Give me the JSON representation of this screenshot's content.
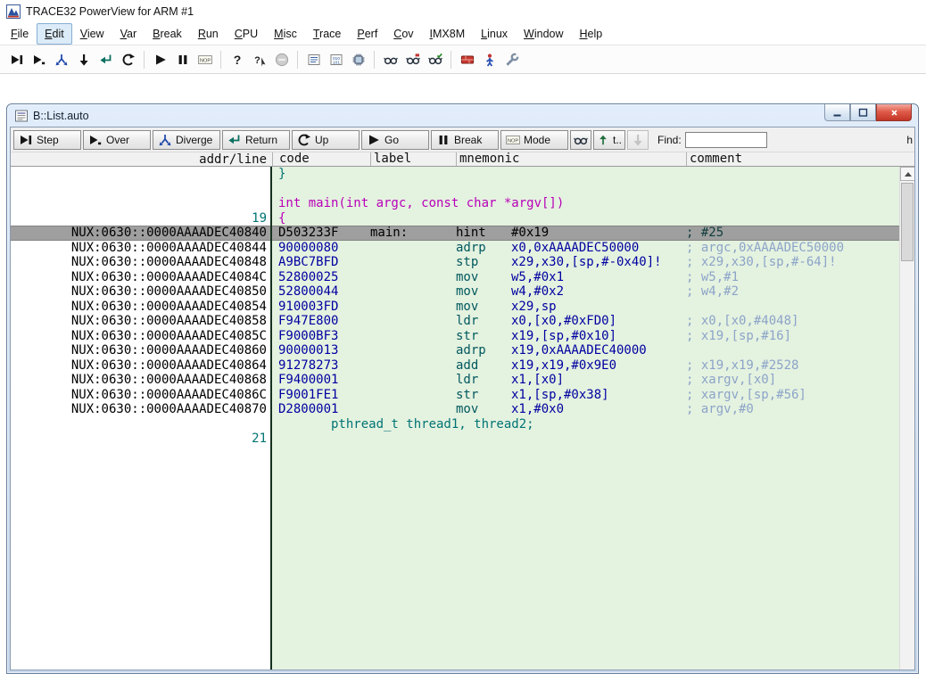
{
  "app": {
    "title": "TRACE32 PowerView for ARM #1"
  },
  "menu": {
    "items": [
      "File",
      "Edit",
      "View",
      "Var",
      "Break",
      "Run",
      "CPU",
      "Misc",
      "Trace",
      "Perf",
      "Cov",
      "IMX8M",
      "Linux",
      "Window",
      "Help"
    ],
    "active": "Edit"
  },
  "main_toolbar": {
    "groups": [
      [
        "step-icon",
        "step-over-icon",
        "step-diverge-icon",
        "run-down-icon",
        "return-icon",
        "up-icon"
      ],
      [
        "go-icon",
        "break-icon",
        "mode-icon"
      ],
      [
        "help-icon",
        "context-help-icon",
        "stop-icon"
      ],
      [
        "list-icon",
        "dump-icon",
        "chip-icon"
      ],
      [
        "watch-icon",
        "watch-var-icon",
        "watch-edit-icon"
      ],
      [
        "breakpoint-list-icon",
        "state-icon",
        "tools-icon"
      ]
    ]
  },
  "list_window": {
    "title": "B::List.auto",
    "window_buttons": [
      "minimize",
      "maximize",
      "close"
    ],
    "toolbar": {
      "buttons": [
        {
          "label": "Step",
          "icon": "step-icon"
        },
        {
          "label": "Over",
          "icon": "step-over-icon"
        },
        {
          "label": "Diverge",
          "icon": "step-diverge-icon"
        },
        {
          "label": "Return",
          "icon": "return-icon"
        },
        {
          "label": "Up",
          "icon": "up-icon"
        },
        {
          "label": "Go",
          "icon": "go-icon"
        },
        {
          "label": "Break",
          "icon": "break-icon"
        },
        {
          "label": "Mode",
          "icon": "mode-icon"
        }
      ],
      "icon_buttons": [
        {
          "icon": "watch-icon"
        },
        {
          "icon": "top-icon",
          "label": "t.."
        },
        {
          "icon": "down-disabled-icon",
          "disabled": true
        }
      ],
      "find": {
        "label": "Find:",
        "value": ""
      },
      "clipped_text": "h"
    },
    "columns": [
      "addr/line",
      "code",
      "label",
      "mnemonic",
      "comment"
    ],
    "rows": [
      {
        "type": "source",
        "color": "teal",
        "text": "}"
      },
      {
        "type": "blank"
      },
      {
        "type": "source",
        "color": "magenta",
        "text": "int main(int argc, const char *argv[])"
      },
      {
        "type": "source",
        "color": "magenta",
        "line": "19",
        "text": "{"
      },
      {
        "type": "asm",
        "selected": true,
        "addr": "NUX:0630::0000AAAADEC40840",
        "code": "D503233F",
        "label": "main:",
        "op": "hint",
        "args": "#0x19",
        "comment": "; #25"
      },
      {
        "type": "asm",
        "addr": "NUX:0630::0000AAAADEC40844",
        "code": "90000080",
        "op": "adrp",
        "args": "x0,0xAAAADEC50000",
        "comment": "; argc,0xAAAADEC50000"
      },
      {
        "type": "asm",
        "addr": "NUX:0630::0000AAAADEC40848",
        "code": "A9BC7BFD",
        "op": "stp",
        "args": "x29,x30,[sp,#-0x40]!",
        "comment": "; x29,x30,[sp,#-64]!"
      },
      {
        "type": "asm",
        "addr": "NUX:0630::0000AAAADEC4084C",
        "code": "52800025",
        "op": "mov",
        "args": "w5,#0x1",
        "comment": "; w5,#1"
      },
      {
        "type": "asm",
        "addr": "NUX:0630::0000AAAADEC40850",
        "code": "52800044",
        "op": "mov",
        "args": "w4,#0x2",
        "comment": "; w4,#2"
      },
      {
        "type": "asm",
        "addr": "NUX:0630::0000AAAADEC40854",
        "code": "910003FD",
        "op": "mov",
        "args": "x29,sp",
        "comment": ""
      },
      {
        "type": "asm",
        "addr": "NUX:0630::0000AAAADEC40858",
        "code": "F947E800",
        "op": "ldr",
        "args": "x0,[x0,#0xFD0]",
        "comment": "; x0,[x0,#4048]"
      },
      {
        "type": "asm",
        "addr": "NUX:0630::0000AAAADEC4085C",
        "code": "F9000BF3",
        "op": "str",
        "args": "x19,[sp,#0x10]",
        "comment": "; x19,[sp,#16]"
      },
      {
        "type": "asm",
        "addr": "NUX:0630::0000AAAADEC40860",
        "code": "90000013",
        "op": "adrp",
        "args": "x19,0xAAAADEC40000",
        "comment": ""
      },
      {
        "type": "asm",
        "addr": "NUX:0630::0000AAAADEC40864",
        "code": "91278273",
        "op": "add",
        "args": "x19,x19,#0x9E0",
        "comment": "; x19,x19,#2528"
      },
      {
        "type": "asm",
        "addr": "NUX:0630::0000AAAADEC40868",
        "code": "F9400001",
        "op": "ldr",
        "args": "x1,[x0]",
        "comment": "; xargv,[x0]"
      },
      {
        "type": "asm",
        "addr": "NUX:0630::0000AAAADEC4086C",
        "code": "F9001FE1",
        "op": "str",
        "args": "x1,[sp,#0x38]",
        "comment": "; xargv,[sp,#56]"
      },
      {
        "type": "asm",
        "addr": "NUX:0630::0000AAAADEC40870",
        "code": "D2800001",
        "op": "mov",
        "args": "x1,#0x0",
        "comment": "; argv,#0"
      },
      {
        "type": "source",
        "color": "teal",
        "text": "       pthread_t thread1, thread2;"
      },
      {
        "type": "source",
        "color": "teal",
        "line": "21",
        "text": ""
      }
    ]
  },
  "colors": {
    "teal": "#007474",
    "magenta": "#b800b8",
    "hex": "#0000a0",
    "op": "#00585e",
    "args": "#0000a0",
    "comment": "#8ca4c8",
    "selcomment": "#103c3c",
    "selbg": "#9f9f9f",
    "addrbg": "#ffffff",
    "listbg": "#e4f2e0",
    "divider": "#15311f",
    "close_red": "#c23527"
  }
}
